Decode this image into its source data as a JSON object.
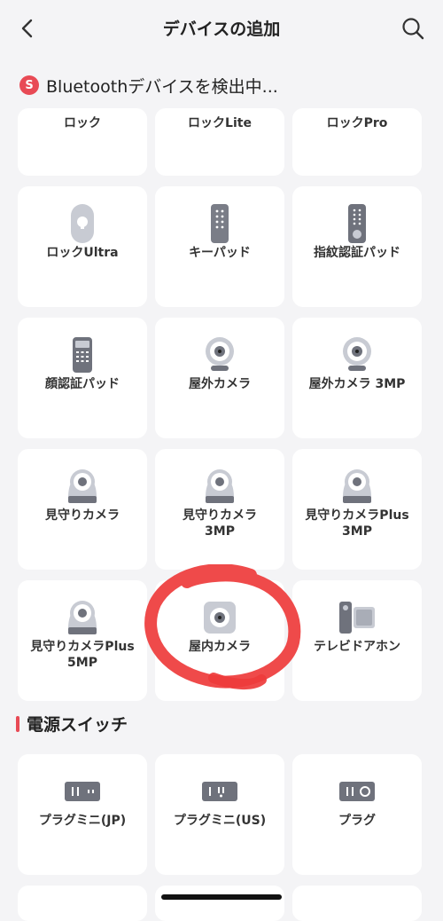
{
  "header": {
    "title": "デバイスの追加",
    "back_icon": "chevron-left-icon",
    "search_icon": "search-icon"
  },
  "scan": {
    "badge": "S",
    "text": "Bluetoothデバイスを検出中..."
  },
  "devices": [
    {
      "label": "ロック",
      "icon": "lock-icon"
    },
    {
      "label": "ロックLite",
      "icon": "lock-lite-icon"
    },
    {
      "label": "ロックPro",
      "icon": "lock-pro-icon"
    },
    {
      "label": "ロックUltra",
      "icon": "lock-ultra-icon"
    },
    {
      "label": "キーパッド",
      "icon": "keypad-icon"
    },
    {
      "label": "指紋認証パッド",
      "icon": "fingerprint-pad-icon"
    },
    {
      "label": "顔認証パッド",
      "icon": "face-pad-icon"
    },
    {
      "label": "屋外カメラ",
      "icon": "outdoor-camera-icon"
    },
    {
      "label": "屋外カメラ 3MP",
      "icon": "outdoor-camera-3mp-icon"
    },
    {
      "label": "見守りカメラ",
      "icon": "pan-tilt-camera-icon"
    },
    {
      "label": "見守りカメラ\n3MP",
      "icon": "pan-tilt-camera-3mp-icon"
    },
    {
      "label": "見守りカメラPlus\n3MP",
      "icon": "pan-tilt-camera-plus-3mp-icon"
    },
    {
      "label": "見守りカメラPlus\n5MP",
      "icon": "pan-tilt-camera-plus-5mp-icon"
    },
    {
      "label": "屋内カメラ",
      "icon": "indoor-camera-icon"
    },
    {
      "label": "テレビドアホン",
      "icon": "video-doorbell-icon"
    }
  ],
  "power_section": {
    "title": "電源スイッチ",
    "items": [
      {
        "label": "プラグミニ(JP)",
        "icon": "plug-mini-jp-icon"
      },
      {
        "label": "プラグミニ(US)",
        "icon": "plug-mini-us-icon"
      },
      {
        "label": "プラグ",
        "icon": "plug-icon"
      }
    ]
  },
  "colors": {
    "accent": "#e84a55",
    "background": "#f4f4f6",
    "card": "#ffffff",
    "annotation": "#ee3b3b"
  }
}
